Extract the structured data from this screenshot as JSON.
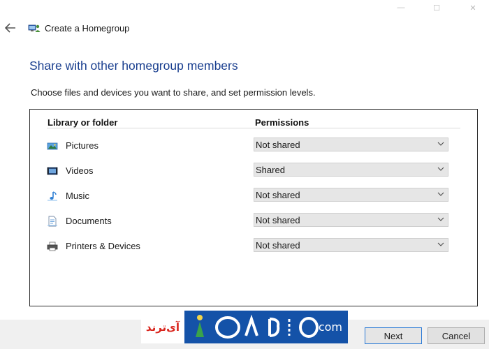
{
  "window": {
    "title": "Create a Homegroup",
    "controls": {
      "minimize": "—",
      "maximize": "☐",
      "close": "✕"
    }
  },
  "page": {
    "heading": "Share with other homegroup members",
    "instructions": "Choose files and devices you want to share, and set permission levels."
  },
  "table": {
    "columns": {
      "library": "Library or folder",
      "permissions": "Permissions"
    },
    "rows": [
      {
        "icon": "pictures-icon",
        "label": "Pictures",
        "permission": "Not shared"
      },
      {
        "icon": "videos-icon",
        "label": "Videos",
        "permission": "Shared"
      },
      {
        "icon": "music-icon",
        "label": "Music",
        "permission": "Not shared"
      },
      {
        "icon": "documents-icon",
        "label": "Documents",
        "permission": "Not shared"
      },
      {
        "icon": "printers-devices-icon",
        "label": "Printers & Devices",
        "permission": "Not shared"
      }
    ]
  },
  "footer": {
    "next": "Next",
    "cancel": "Cancel"
  },
  "watermark": {
    "text_left": "آی‌ترند",
    "text_right": ".com"
  },
  "colors": {
    "heading": "#1a3f8f",
    "select_bg": "#e6e6e6",
    "footer_bg": "#f0f0f0",
    "focus_border": "#2a7ad6",
    "watermark_blue": "#1452a8"
  }
}
